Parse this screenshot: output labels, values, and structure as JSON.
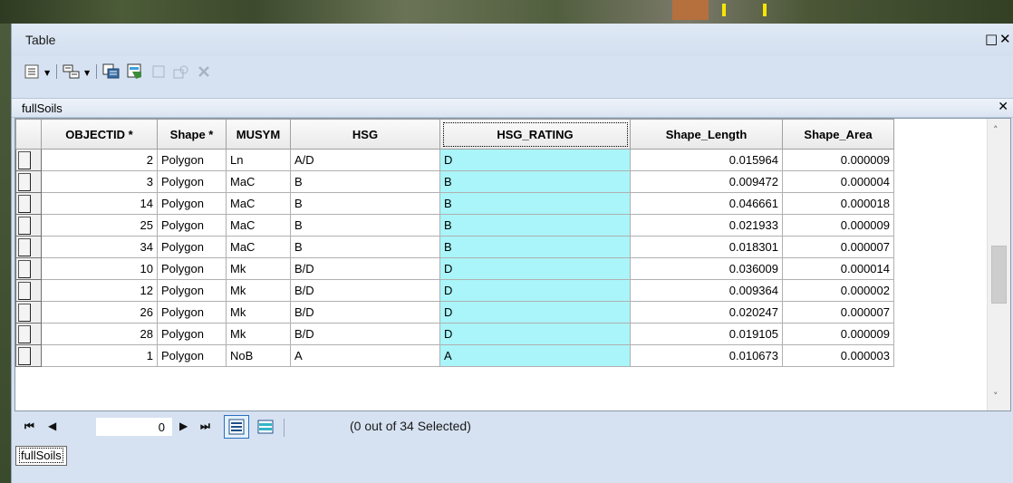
{
  "window": {
    "title": "Table",
    "restore_glyph": "□",
    "close_glyph": "✕"
  },
  "table": {
    "name": "fullSoils",
    "close_glyph": "✕",
    "columns": [
      "OBJECTID *",
      "Shape *",
      "MUSYM",
      "HSG",
      "HSG_RATING",
      "Shape_Length",
      "Shape_Area"
    ],
    "rows": [
      [
        "2",
        "Polygon",
        "Ln",
        "A/D",
        "D",
        "0.015964",
        "0.000009"
      ],
      [
        "3",
        "Polygon",
        "MaC",
        "B",
        "B",
        "0.009472",
        "0.000004"
      ],
      [
        "14",
        "Polygon",
        "MaC",
        "B",
        "B",
        "0.046661",
        "0.000018"
      ],
      [
        "25",
        "Polygon",
        "MaC",
        "B",
        "B",
        "0.021933",
        "0.000009"
      ],
      [
        "34",
        "Polygon",
        "MaC",
        "B",
        "B",
        "0.018301",
        "0.000007"
      ],
      [
        "10",
        "Polygon",
        "Mk",
        "B/D",
        "D",
        "0.036009",
        "0.000014"
      ],
      [
        "12",
        "Polygon",
        "Mk",
        "B/D",
        "D",
        "0.009364",
        "0.000002"
      ],
      [
        "26",
        "Polygon",
        "Mk",
        "B/D",
        "D",
        "0.020247",
        "0.000007"
      ],
      [
        "28",
        "Polygon",
        "Mk",
        "B/D",
        "D",
        "0.019105",
        "0.000009"
      ],
      [
        "1",
        "Polygon",
        "NoB",
        "A",
        "A",
        "0.010673",
        "0.000003"
      ]
    ]
  },
  "nav": {
    "first_glyph": "⏮",
    "prev_glyph": "◀",
    "record": "0",
    "next_glyph": "▶",
    "last_glyph": "⏭",
    "selection_text": "(0 out of 34 Selected)"
  },
  "scrollbar": {
    "up_glyph": "˄",
    "down_glyph": "˅"
  },
  "tabs": [
    "fullSoils"
  ],
  "colors": {
    "highlight": "#a9f5f9",
    "window_bg": "#d6e2f1",
    "active_view_border": "#2b6fbf"
  }
}
